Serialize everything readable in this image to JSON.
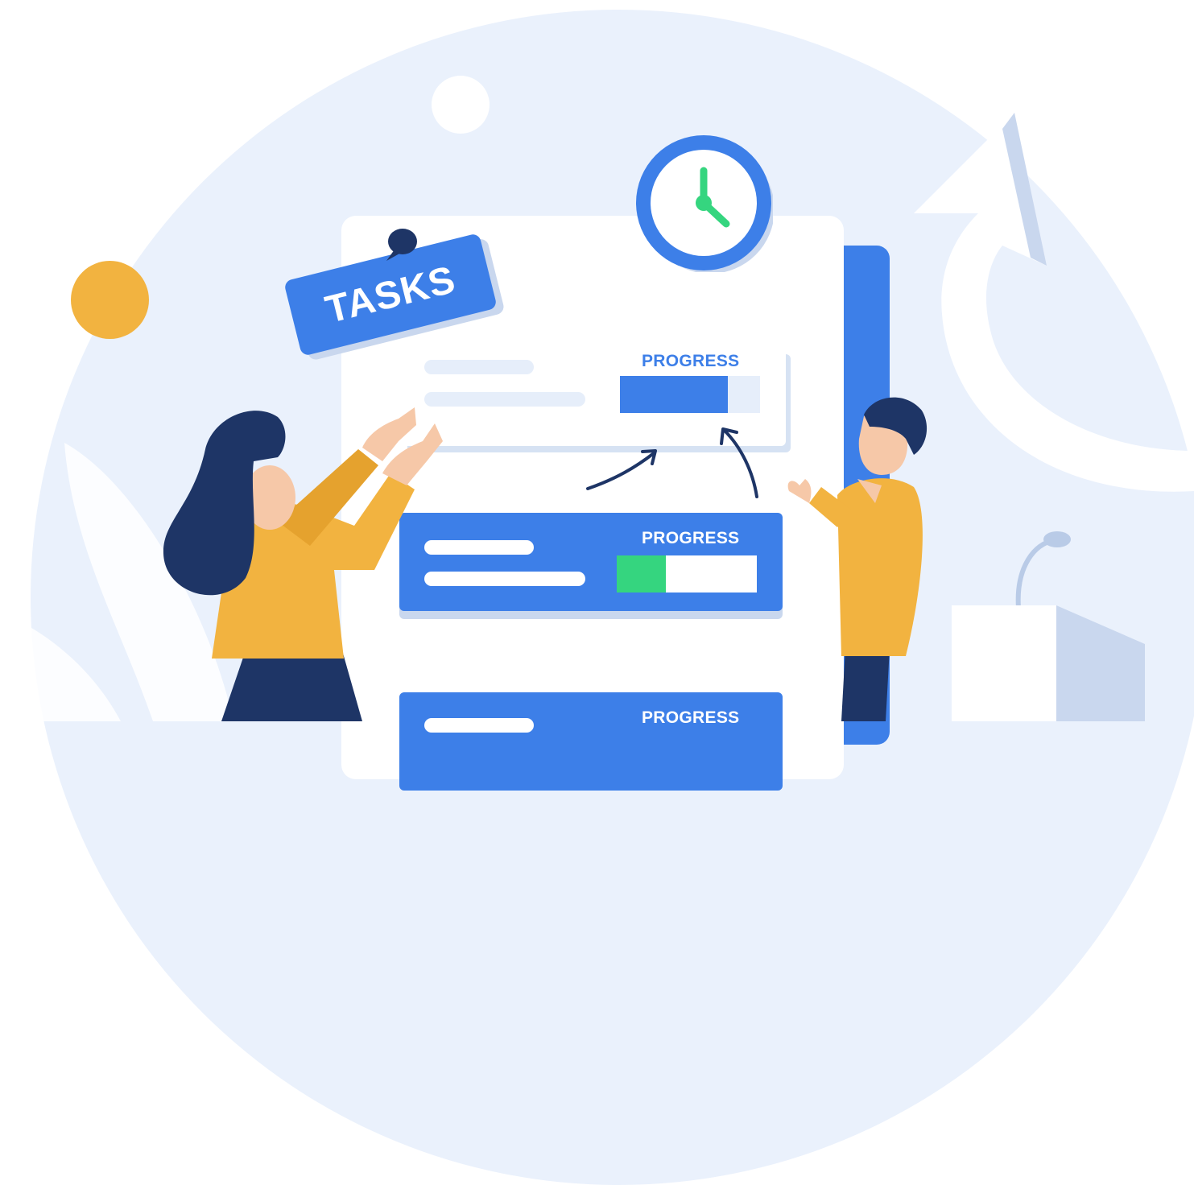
{
  "tag": {
    "label": "TASKS"
  },
  "cards": [
    {
      "progress_label": "PROGRESS",
      "progress": 0.77,
      "fill_color": "#3d7fe8"
    },
    {
      "progress_label": "PROGRESS",
      "progress": 0.35,
      "fill_color": "#35d57f"
    },
    {
      "progress_label": "PROGRESS"
    }
  ],
  "colors": {
    "primary_blue": "#3d7fe8",
    "progress_green": "#35d57f",
    "accent_orange": "#f2b340",
    "navy": "#1e3566",
    "background_tint": "#eaf1fc"
  },
  "icons": [
    "clock-icon",
    "push-pin-icon",
    "arrow-icon",
    "microphone-icon"
  ]
}
